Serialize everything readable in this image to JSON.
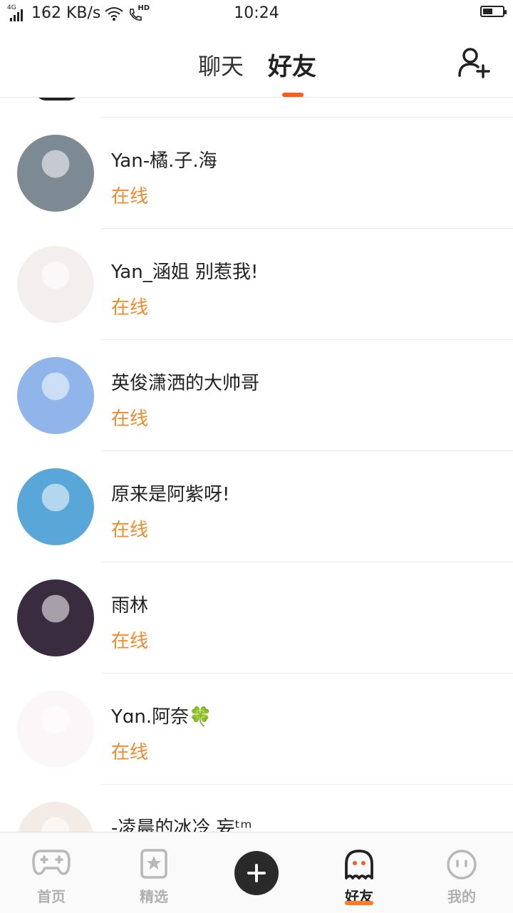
{
  "statusbar": {
    "network": "4G",
    "speed": "162 KB/s",
    "hd": "HD",
    "time": "10:24",
    "battery_level": 0.5
  },
  "header": {
    "tabs": [
      {
        "label": "聊天",
        "active": false
      },
      {
        "label": "好友",
        "active": true
      }
    ],
    "add_friend_icon": "add-user-icon"
  },
  "colors": {
    "accent": "#ff5a1f",
    "online": "#f08a2a",
    "nav_inactive": "#b0b0b0"
  },
  "friends": [
    {
      "name": "Yan-橘.子.海",
      "status": "在线",
      "avatar_bg": "#7d8a94"
    },
    {
      "name": "Yan_涵姐  别惹我!",
      "status": "在线",
      "avatar_bg": "#f4efef"
    },
    {
      "name": "英俊潇洒的大帅哥",
      "status": "在线",
      "avatar_bg": "#8fb5ea"
    },
    {
      "name": "原来是阿紫呀!",
      "status": "在线",
      "avatar_bg": "#58a7d8"
    },
    {
      "name": "雨林",
      "status": "在线",
      "avatar_bg": "#3a2c3f"
    },
    {
      "name": "Yɑn.阿奈🍀",
      "status": "在线",
      "avatar_bg": "#fbf6f7"
    },
    {
      "name": "-凌晨的冰冷.妄ᵗᵐ",
      "status": "",
      "avatar_bg": "#f3ece6"
    }
  ],
  "bottomnav": {
    "items": [
      {
        "label": "首页",
        "icon": "gamepad-icon"
      },
      {
        "label": "精选",
        "icon": "star-bookmark-icon"
      },
      {
        "label": "",
        "icon": "plus-icon"
      },
      {
        "label": "好友",
        "icon": "ghost-icon"
      },
      {
        "label": "我的",
        "icon": "face-icon"
      }
    ]
  }
}
